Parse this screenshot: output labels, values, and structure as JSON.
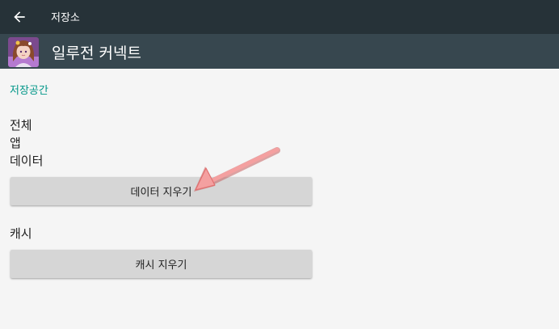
{
  "toolbar": {
    "title": "저장소",
    "back_icon": "arrow-back-icon"
  },
  "app": {
    "name": "일루전 커넥트",
    "icon": "app-avatar-icon"
  },
  "storage": {
    "section_label": "저장공간",
    "total_label": "전체",
    "app_label": "앱",
    "data_label": "데이터",
    "clear_data_button": "데이터 지우기"
  },
  "cache": {
    "label": "캐시",
    "clear_cache_button": "캐시 지우기"
  },
  "colors": {
    "toolbar": "#263238",
    "header": "#37474f",
    "accent": "#009688",
    "background": "#f5f5f5",
    "button": "#d6d6d6",
    "annotation_arrow": "#f08080"
  }
}
